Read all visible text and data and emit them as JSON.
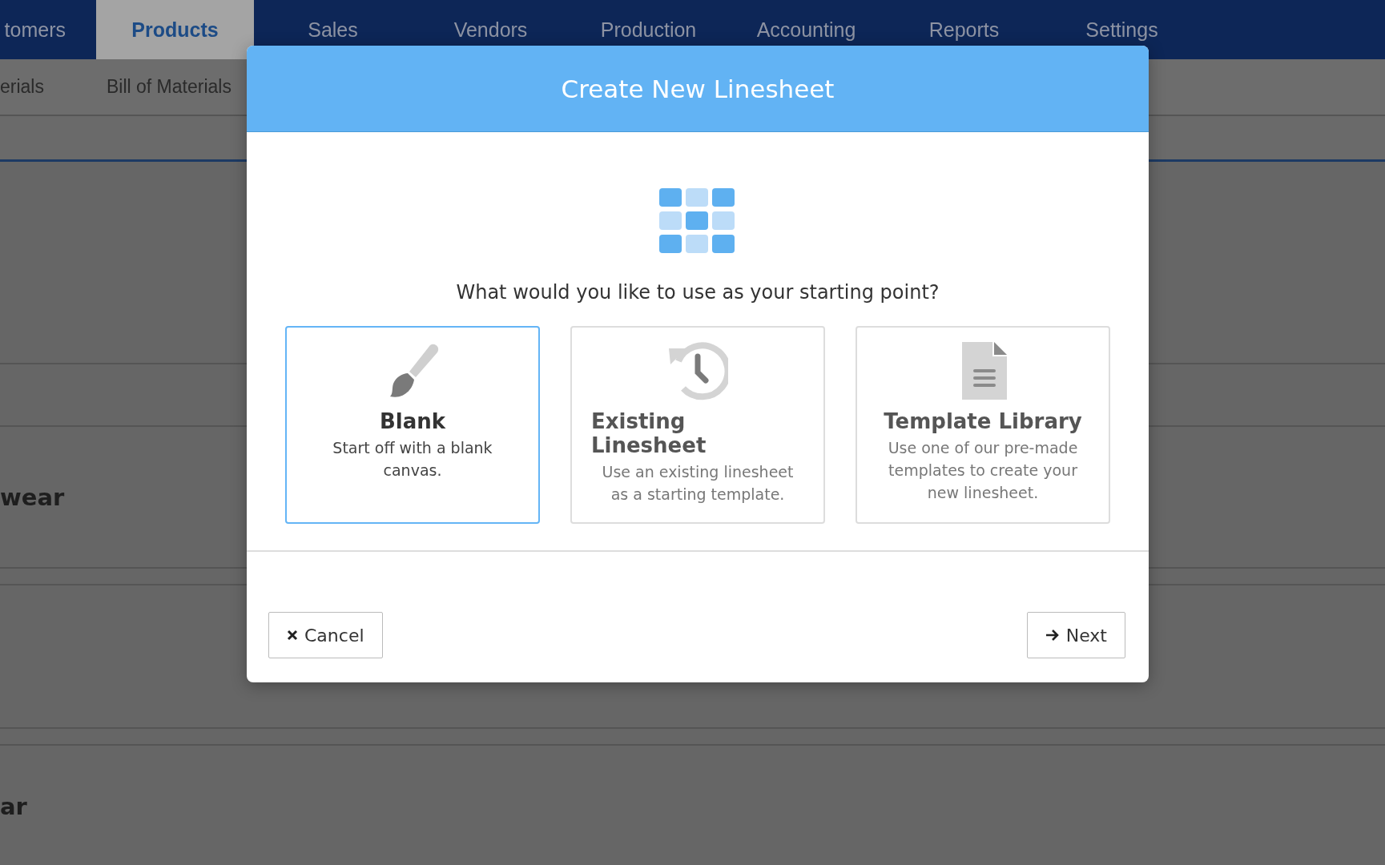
{
  "nav": {
    "tabs": [
      {
        "label": "tomers",
        "selected": false
      },
      {
        "label": "Products",
        "selected": true
      },
      {
        "label": "Sales",
        "selected": false
      },
      {
        "label": "Vendors",
        "selected": false
      },
      {
        "label": "Production",
        "selected": false
      },
      {
        "label": "Accounting",
        "selected": false
      },
      {
        "label": "Reports",
        "selected": false
      },
      {
        "label": "Settings",
        "selected": false
      }
    ]
  },
  "subnav": {
    "items": [
      "erials",
      "Bill of Materials"
    ]
  },
  "background_rows": [
    "wear",
    "ar"
  ],
  "dialog": {
    "title": "Create New Linesheet",
    "question": "What would you like to use as your starting point?",
    "options": [
      {
        "kind": "blank",
        "title": "Blank",
        "description": "Start off with a blank canvas.",
        "selected": true
      },
      {
        "kind": "existing",
        "title": "Existing Linesheet",
        "description": "Use an existing linesheet as a starting template.",
        "selected": false
      },
      {
        "kind": "template",
        "title": "Template Library",
        "description": "Use one of our pre-made templates to create your new linesheet.",
        "selected": false
      }
    ],
    "cancel_button": "Cancel",
    "next_button": "Next"
  }
}
